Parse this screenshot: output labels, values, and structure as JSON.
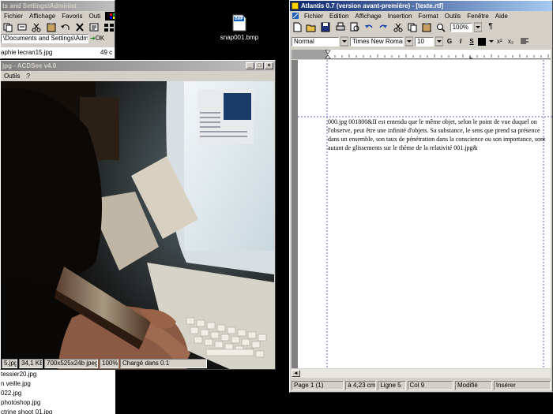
{
  "explorer": {
    "title": "ts and Settings\\Administ",
    "menu": [
      "Fichier",
      "Affichage",
      "Favoris",
      "Outi"
    ],
    "address": "\\Documents and Settings\\Adm",
    "ok_label": "OK",
    "file_item": "aphie lecran15.jpg",
    "size_snippet": "49 c"
  },
  "acdsee": {
    "title": "jpg - ACDSee v4.0",
    "menu": [
      "Outils",
      "?"
    ],
    "status": [
      "5.jpg",
      "34,1 KB",
      "700x525x24b jpeg",
      "100%",
      "Chargé dans 0.1"
    ]
  },
  "filelist": [
    " tessier20.jpg",
    "n veille.jpg",
    "022.jpg",
    "photoshop.jpg",
    "ctrine shoot 01.jpg"
  ],
  "desktop_icon": {
    "label": "snap001.bmp",
    "badge": "BMP"
  },
  "atlantis": {
    "title": "Atlantis 0.7 (version avant-première) - [texte.rtf]",
    "menu": [
      "Fichier",
      "Edition",
      "Affichage",
      "Insertion",
      "Format",
      "Outils",
      "Fenêtre",
      "Aide"
    ],
    "zoom": "100%",
    "style": "Normal",
    "font": "Times New Roman",
    "size": "10",
    "format_buttons": [
      "G",
      "I",
      "S"
    ],
    "doc_text": "000.jpg 001800&II est entendu que le même objet, selon le point de vue duquel on l'observe, peut être une infinité d'objets. Sa substance, le sens que prend sa présence dans un ensemble, son taux de pénétration dans la conscience ou son importance, sont autant de glissements sur le thème de la relativité 001.jpg&",
    "status": [
      "Page 1 (1)",
      "à 4,23 cm",
      "Ligne 5",
      "Col 9",
      "Modifié",
      "Insérer"
    ]
  },
  "colors": {
    "title_active": "#0a246a",
    "title_inactive": "#808080",
    "face": "#d4d0c8"
  }
}
